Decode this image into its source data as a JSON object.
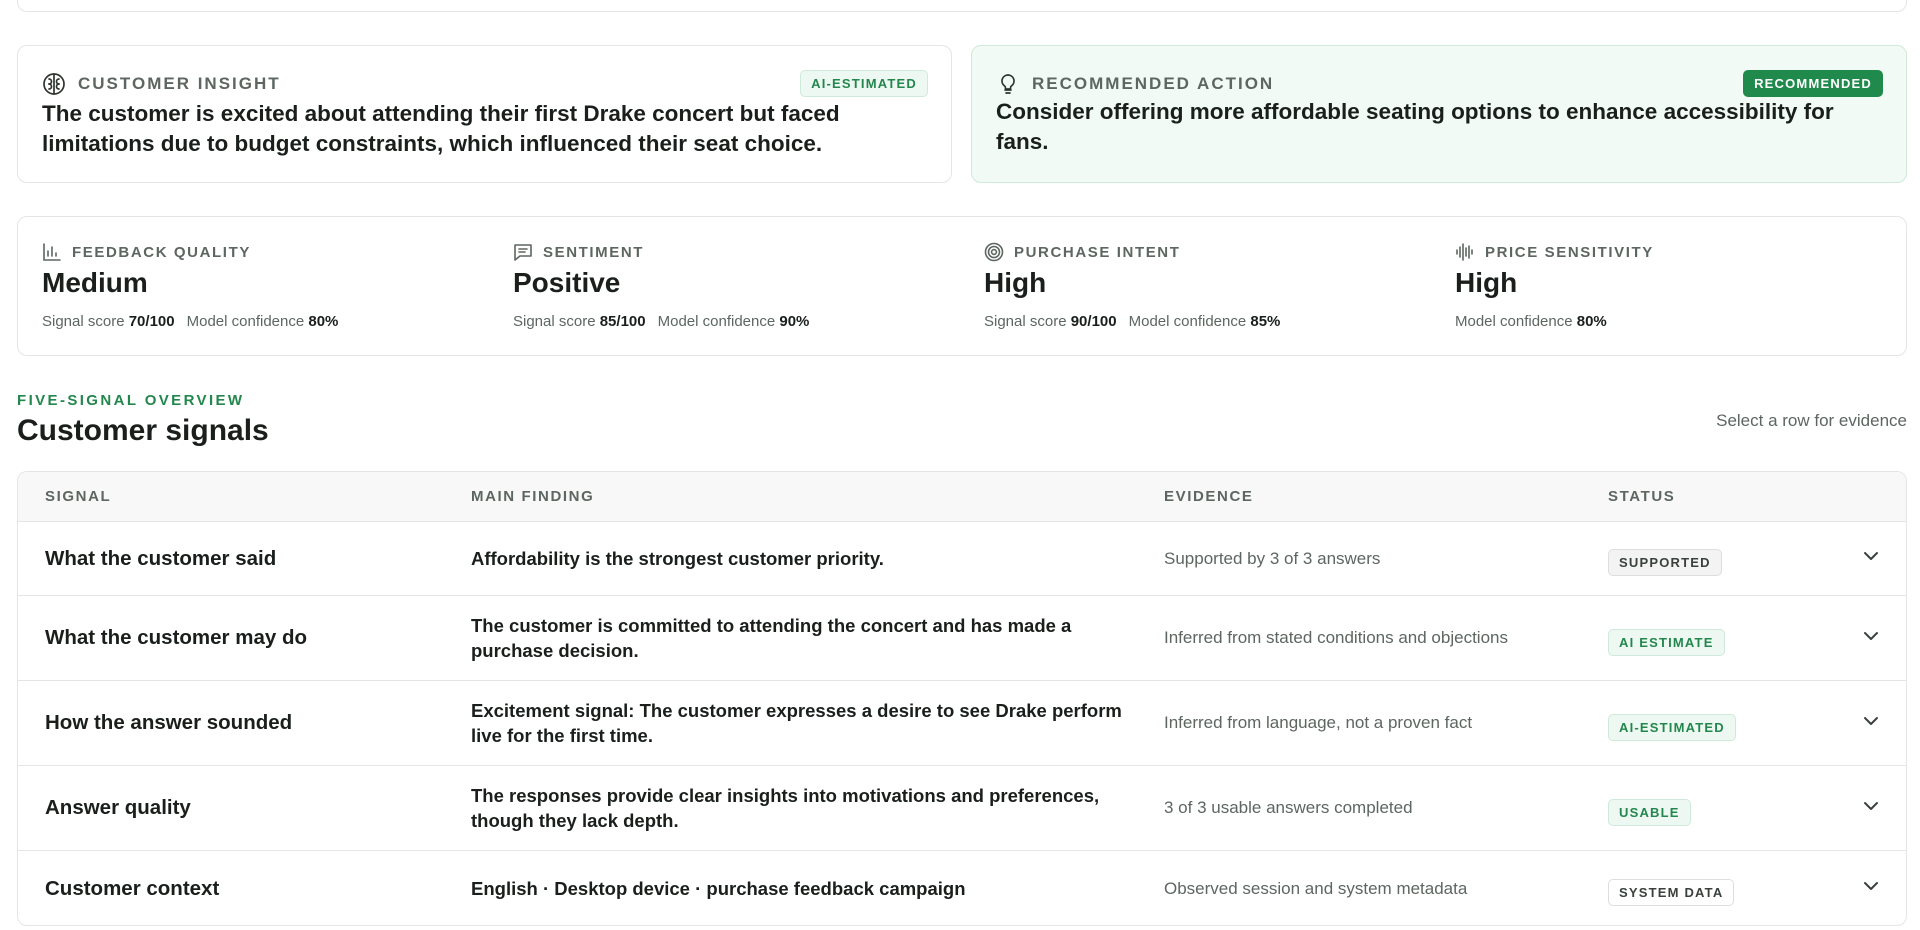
{
  "insight": {
    "label": "CUSTOMER INSIGHT",
    "badge": "AI-ESTIMATED",
    "text": "The customer is excited about attending their first Drake concert but faced limitations due to budget constraints, which influenced their seat choice.",
    "icon": "brain-icon"
  },
  "action": {
    "label": "RECOMMENDED ACTION",
    "badge": "RECOMMENDED",
    "text": "Consider offering more affordable seating options to enhance accessibility for fans.",
    "icon": "lightbulb-icon"
  },
  "metrics": [
    {
      "label": "FEEDBACK QUALITY",
      "value": "Medium",
      "signal_label": "Signal score",
      "signal": "70/100",
      "confidence_label": "Model confidence",
      "confidence": "80%",
      "icon": "bar-chart-icon"
    },
    {
      "label": "SENTIMENT",
      "value": "Positive",
      "signal_label": "Signal score",
      "signal": "85/100",
      "confidence_label": "Model confidence",
      "confidence": "90%",
      "icon": "message-icon"
    },
    {
      "label": "PURCHASE INTENT",
      "value": "High",
      "signal_label": "Signal score",
      "signal": "90/100",
      "confidence_label": "Model confidence",
      "confidence": "85%",
      "icon": "target-icon"
    },
    {
      "label": "PRICE SENSITIVITY",
      "value": "High",
      "confidence_label": "Model confidence",
      "confidence": "80%",
      "icon": "waveform-icon"
    }
  ],
  "section": {
    "eyebrow": "FIVE-SIGNAL OVERVIEW",
    "title": "Customer signals",
    "hint": "Select a row for evidence"
  },
  "table": {
    "headers": [
      "SIGNAL",
      "MAIN FINDING",
      "EVIDENCE",
      "STATUS"
    ],
    "rows": [
      {
        "signal": "What the customer said",
        "finding": "Affordability is the strongest customer priority.",
        "evidence": "Supported by 3 of 3 answers",
        "status": "SUPPORTED"
      },
      {
        "signal": "What the customer may do",
        "finding": "The customer is committed to attending the concert and has made a purchase decision.",
        "evidence": "Inferred from stated conditions and objections",
        "status": "AI ESTIMATE"
      },
      {
        "signal": "How the answer sounded",
        "finding": "Excitement signal: The customer expresses a desire to see Drake perform live for the first time.",
        "evidence": "Inferred from language, not a proven fact",
        "status": "AI-ESTIMATED"
      },
      {
        "signal": "Answer quality",
        "finding": "The responses provide clear insights into motivations and preferences, though they lack depth.",
        "evidence": "3 of 3 usable answers completed",
        "status": "USABLE"
      },
      {
        "signal": "Customer context",
        "finding": "English · Desktop device · purchase feedback campaign",
        "evidence": "Observed session and system metadata",
        "status": "SYSTEM DATA"
      }
    ]
  },
  "colors": {
    "accent": "#1f8a4c",
    "accent_text": "#23874d",
    "accent_bg": "#eef8f2",
    "muted_text": "#5d6661",
    "border": "#e3e6e4"
  }
}
